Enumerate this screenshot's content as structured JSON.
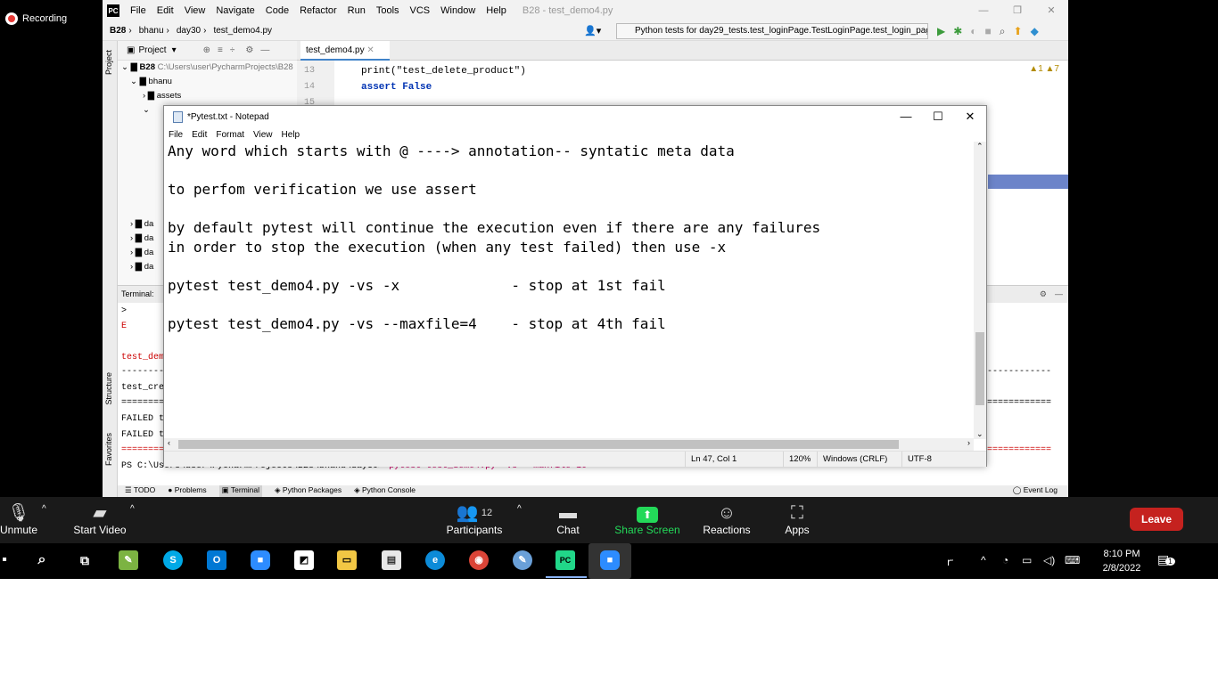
{
  "recording": {
    "label": "Recording"
  },
  "ide": {
    "logo": "PC",
    "menu": [
      "File",
      "Edit",
      "View",
      "Navigate",
      "Code",
      "Refactor",
      "Run",
      "Tools",
      "VCS",
      "Window",
      "Help"
    ],
    "window_title": "B28 - test_demo4.py",
    "breadcrumbs": [
      "B28",
      "bhanu",
      "day30",
      "test_demo4.py"
    ],
    "run_config": "Python tests for day29_tests.test_loginPage.TestLoginPage.test_login_page",
    "project_label": "Project",
    "side_labels": {
      "project": "Project",
      "structure": "Structure",
      "favorites": "Favorites"
    },
    "tree": {
      "root_name": "B28",
      "root_path": "C:\\Users\\user\\PycharmProjects\\B28",
      "items": [
        "bhanu",
        "assets",
        "da",
        "da",
        "da",
        "da",
        "da"
      ]
    },
    "tab": "test_demo4.py",
    "editor": {
      "lines": [
        {
          "no": "13",
          "code": "print(\"test_delete_product\")"
        },
        {
          "no": "14",
          "code": "assert False"
        },
        {
          "no": "15",
          "code": ""
        }
      ],
      "inspections": "▲1 ▲7"
    },
    "terminal": {
      "label": "Terminal:",
      "lines": [
        ">",
        "E",
        "",
        "test_dem",
        "-----------",
        "test_cre",
        "===========",
        "FAILED t",
        "FAILED t",
        "==========="
      ],
      "prompt": "PS C:\\Users\\user\\PycharmProjects\\B28\\bhanu\\day30> ",
      "command": "pytest test_demo4.py -vs --maxfile=10",
      "right_dashes": "------------",
      "right_equals": "============",
      "right_equals2": "============"
    },
    "bottom_tabs": [
      "TODO",
      "Problems",
      "Terminal",
      "Python Packages",
      "Python Console"
    ],
    "event_log": "Event Log"
  },
  "notepad": {
    "title": "*Pytest.txt - Notepad",
    "menu": [
      "File",
      "Edit",
      "Format",
      "View",
      "Help"
    ],
    "text": "Any word which starts with @ ----> annotation-- syntatic meta data\n\nto perfom verification we use assert\n\nby default pytest will continue the execution even if there are any failures\nin order to stop the execution (when any test failed) then use -x\n\npytest test_demo4.py -vs -x             - stop at 1st fail\n\npytest test_demo4.py -vs --maxfile=4    - stop at 4th fail\n",
    "status": {
      "position": "Ln 47, Col 1",
      "zoom": "120%",
      "line_ending": "Windows (CRLF)",
      "encoding": "UTF-8"
    }
  },
  "zoom": {
    "unmute": "Unmute",
    "start_video": "Start Video",
    "participants": "Participants",
    "participants_count": "12",
    "chat": "Chat",
    "share_screen": "Share Screen",
    "reactions": "Reactions",
    "apps": "Apps",
    "leave": "Leave"
  },
  "taskbar": {
    "time": "8:10 PM",
    "date": "2/8/2022",
    "notification_count": "1"
  },
  "colors": {
    "accent": "#4083c9",
    "share_green": "#23d959",
    "leave_red": "#c5221f"
  }
}
